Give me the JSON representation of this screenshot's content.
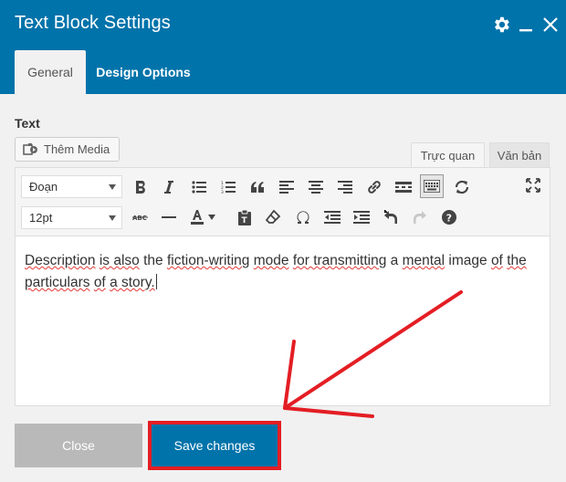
{
  "dialog": {
    "title": "Text Block Settings"
  },
  "tabs": [
    {
      "label": "General",
      "active": true
    },
    {
      "label": "Design Options",
      "active": false
    }
  ],
  "field": {
    "label": "Text"
  },
  "media_button": {
    "label": "Thêm Media"
  },
  "editor_modes": {
    "visual": "Trực quan",
    "text": "Văn bản"
  },
  "toolbar": {
    "format_select": "Đoạn",
    "size_select": "12pt"
  },
  "content": {
    "w1": "Description",
    "t1": " ",
    "w2": "is also",
    "t2": " the ",
    "w3": "fiction-writing",
    "t3": " ",
    "w4": "mode",
    "t4": " ",
    "w5": "for transmitting",
    "t5": " a ",
    "w6": "mental",
    "t6": " image ",
    "w7": "of",
    "t7": " ",
    "w8": "the particulars",
    "t8": " ",
    "w9": "of",
    "t9": " ",
    "w10": "a story."
  },
  "footer": {
    "close_label": "Close",
    "save_label": "Save changes"
  },
  "colors": {
    "accent": "#0073aa",
    "highlight": "#e31e24"
  }
}
